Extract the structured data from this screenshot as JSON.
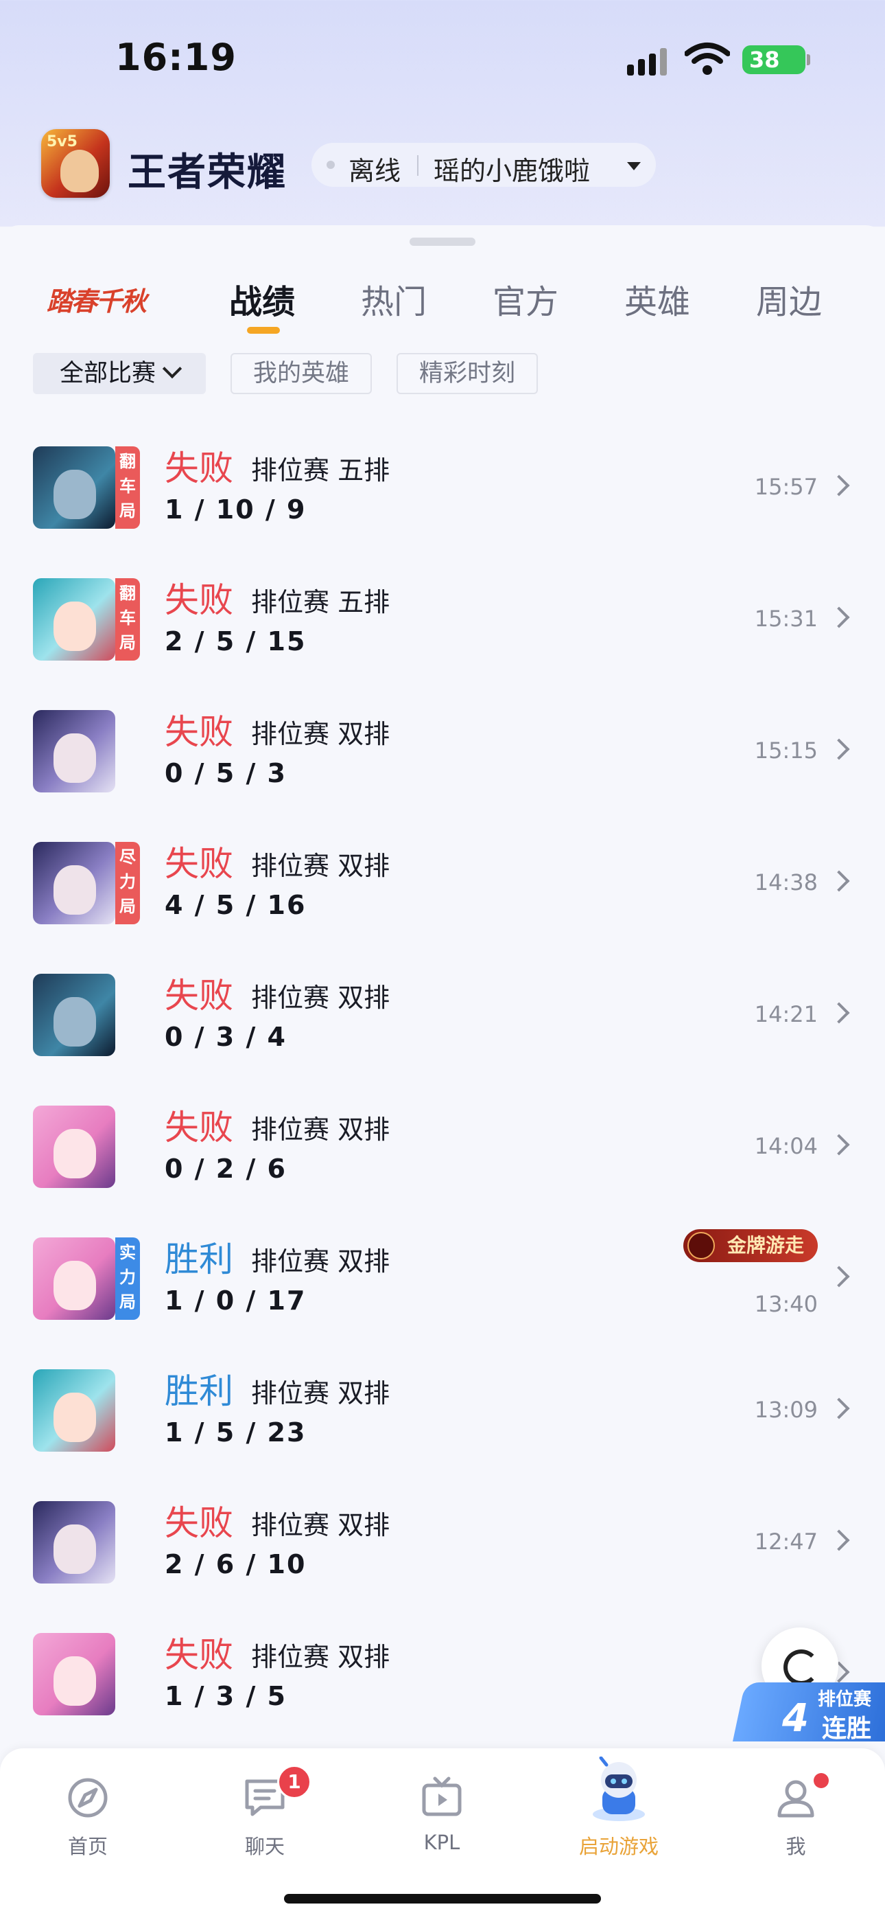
{
  "status_bar": {
    "time": "16:19",
    "battery": "38"
  },
  "header": {
    "app_title": "王者荣耀",
    "app_icon_text": "5v5",
    "account_status": "离线",
    "account_name": "瑶的小鹿饿啦"
  },
  "tabs": {
    "brand_label": "踏春千秋",
    "items": [
      {
        "label": "战绩",
        "active": true
      },
      {
        "label": "热门",
        "active": false
      },
      {
        "label": "官方",
        "active": false
      },
      {
        "label": "英雄",
        "active": false
      },
      {
        "label": "周边",
        "active": false
      }
    ]
  },
  "filters": {
    "all_matches": "全部比赛",
    "my_heroes": "我的英雄",
    "highlights": "精彩时刻"
  },
  "matches": [
    {
      "result": "失败",
      "type": "lose",
      "mode": "排位赛 五排",
      "kda": "1 / 10 / 9",
      "time": "15:57",
      "badge": "翻车局",
      "badge_color": "red",
      "hero": "teal-warrior"
    },
    {
      "result": "失败",
      "type": "lose",
      "mode": "排位赛 五排",
      "kda": "2 / 5 / 15",
      "time": "15:31",
      "badge": "翻车局",
      "badge_color": "red",
      "hero": "cyan-girl"
    },
    {
      "result": "失败",
      "type": "lose",
      "mode": "排位赛 双排",
      "kda": "0 / 5 / 3",
      "time": "15:15",
      "badge": "",
      "badge_color": "",
      "hero": "purple-silver"
    },
    {
      "result": "失败",
      "type": "lose",
      "mode": "排位赛 双排",
      "kda": "4 / 5 / 16",
      "time": "14:38",
      "badge": "尽力局",
      "badge_color": "red",
      "hero": "purple-silver"
    },
    {
      "result": "失败",
      "type": "lose",
      "mode": "排位赛 双排",
      "kda": "0 / 3 / 4",
      "time": "14:21",
      "badge": "",
      "badge_color": "",
      "hero": "teal-warrior"
    },
    {
      "result": "失败",
      "type": "lose",
      "mode": "排位赛 双排",
      "kda": "0 / 2 / 6",
      "time": "14:04",
      "badge": "",
      "badge_color": "",
      "hero": "pink-girl"
    },
    {
      "result": "胜利",
      "type": "win",
      "mode": "排位赛 双排",
      "kda": "1 / 0 / 17",
      "time": "13:40",
      "badge": "实力局",
      "badge_color": "blue",
      "hero": "pink-girl",
      "medal": "金牌游走"
    },
    {
      "result": "胜利",
      "type": "win",
      "mode": "排位赛 双排",
      "kda": "1 / 5 / 23",
      "time": "13:09",
      "badge": "",
      "badge_color": "",
      "hero": "cyan-girl"
    },
    {
      "result": "失败",
      "type": "lose",
      "mode": "排位赛 双排",
      "kda": "2 / 6 / 10",
      "time": "12:47",
      "badge": "",
      "badge_color": "",
      "hero": "purple-silver"
    },
    {
      "result": "失败",
      "type": "lose",
      "mode": "排位赛 双排",
      "kda": "1 / 3 / 5",
      "time": "",
      "badge": "",
      "badge_color": "",
      "hero": "pink-girl"
    }
  ],
  "streak": {
    "label": "排位赛",
    "count": "4",
    "text": "连胜"
  },
  "tabbar": [
    {
      "label": "首页",
      "icon": "compass-icon",
      "active": false
    },
    {
      "label": "聊天",
      "icon": "chat-icon",
      "active": false,
      "badge": "1"
    },
    {
      "label": "KPL",
      "icon": "tv-icon",
      "active": false
    },
    {
      "label": "启动游戏",
      "icon": "robot-mascot-icon",
      "active": true
    },
    {
      "label": "我",
      "icon": "user-icon",
      "active": false,
      "dot": true
    }
  ],
  "colors": {
    "lose": "#e8464e",
    "win": "#2f8ad6",
    "accent": "#f5a624",
    "active_tab_label": "#e9a338"
  }
}
